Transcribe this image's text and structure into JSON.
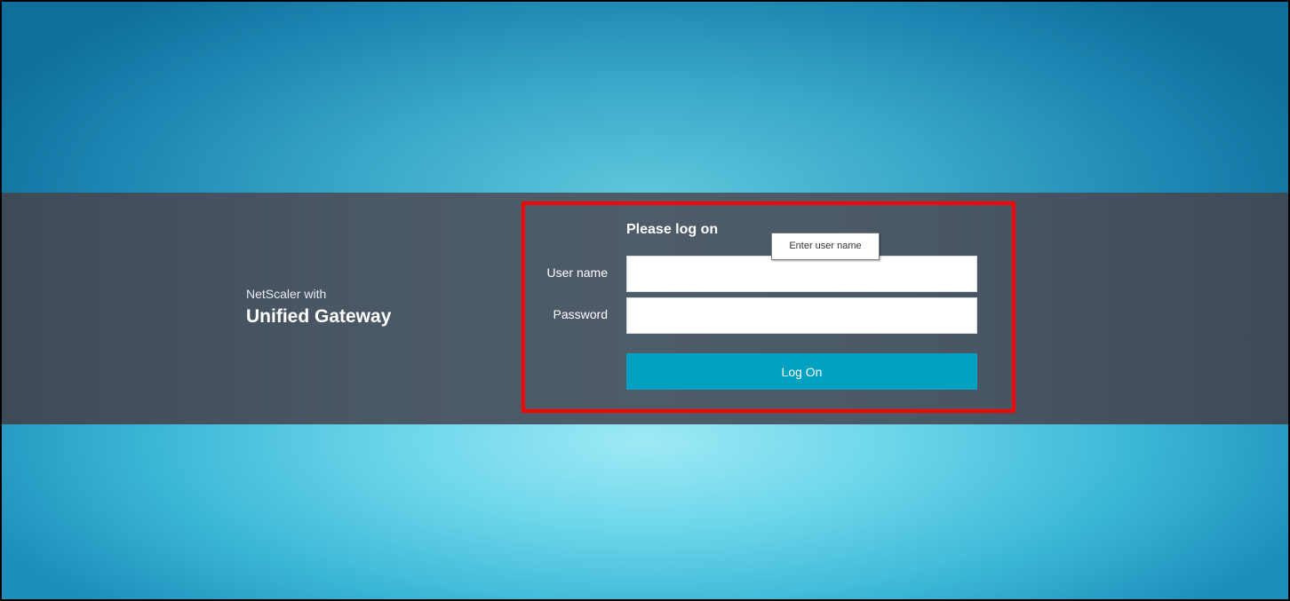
{
  "brand": {
    "subtitle": "NetScaler with",
    "product": "Unified Gateway"
  },
  "login": {
    "title": "Please log on",
    "username_label": "User name",
    "password_label": "Password",
    "username_value": "",
    "password_value": "",
    "logon_label": "Log On"
  },
  "tooltip": {
    "text": "Enter user name"
  },
  "colors": {
    "band": "#4b5866",
    "button": "#02a1c2",
    "highlight": "#ff0000"
  }
}
